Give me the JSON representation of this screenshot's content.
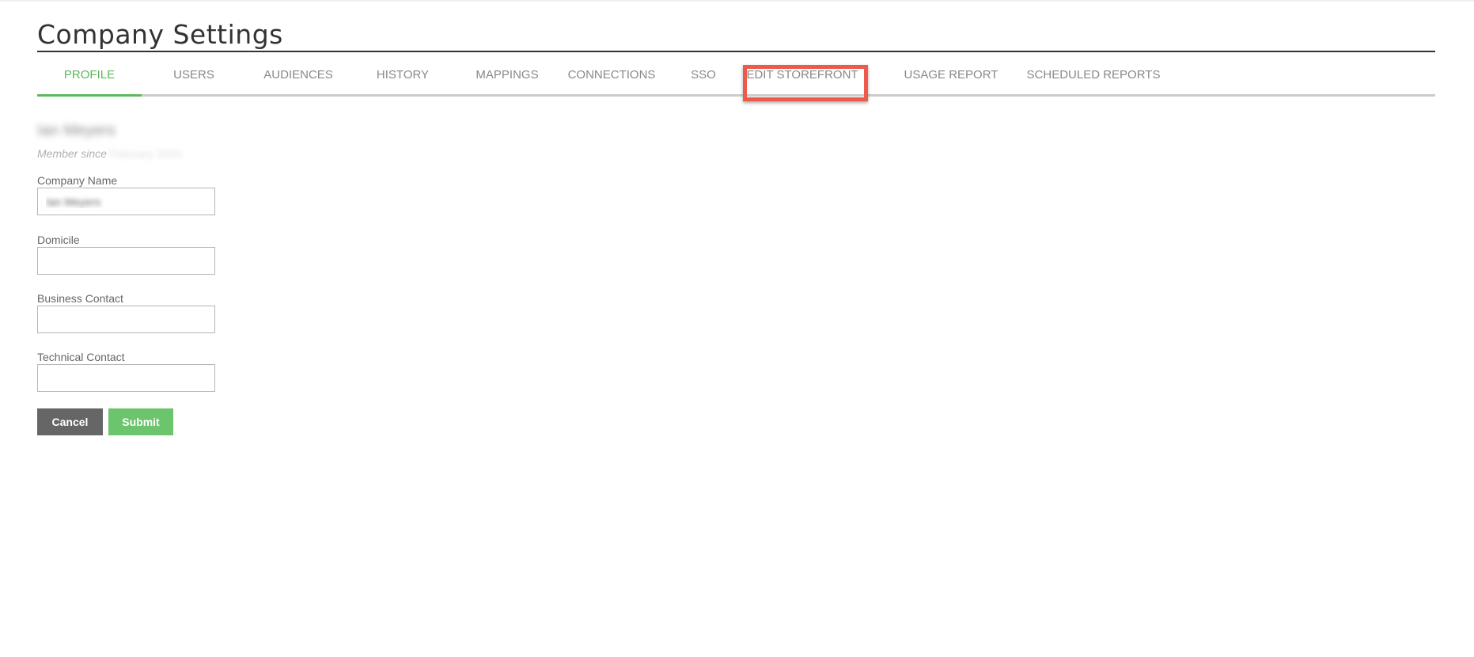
{
  "header": {
    "title": "Company Settings"
  },
  "tabs": [
    {
      "label": "PROFILE",
      "active": true
    },
    {
      "label": "USERS",
      "active": false
    },
    {
      "label": "AUDIENCES",
      "active": false
    },
    {
      "label": "HISTORY",
      "active": false
    },
    {
      "label": "MAPPINGS",
      "active": false
    },
    {
      "label": "CONNECTIONS",
      "active": false
    },
    {
      "label": "SSO",
      "active": false
    },
    {
      "label": "EDIT STOREFRONT",
      "active": false,
      "highlighted": true
    },
    {
      "label": "USAGE REPORT",
      "active": false
    },
    {
      "label": "SCHEDULED REPORTS",
      "active": false
    }
  ],
  "profile": {
    "user_name": "Ian Meyers",
    "member_since_label": "Member since",
    "member_since_value": "February 2020"
  },
  "form": {
    "company_name": {
      "label": "Company Name",
      "value": "Ian Meyers"
    },
    "domicile": {
      "label": "Domicile",
      "value": ""
    },
    "business_contact": {
      "label": "Business Contact",
      "value": ""
    },
    "technical_contact": {
      "label": "Technical Contact",
      "value": ""
    }
  },
  "actions": {
    "cancel_label": "Cancel",
    "submit_label": "Submit"
  },
  "colors": {
    "accent": "#5cb85c",
    "submit": "#6cc46c",
    "cancel": "#666666",
    "highlight": "#ee5a4a"
  }
}
